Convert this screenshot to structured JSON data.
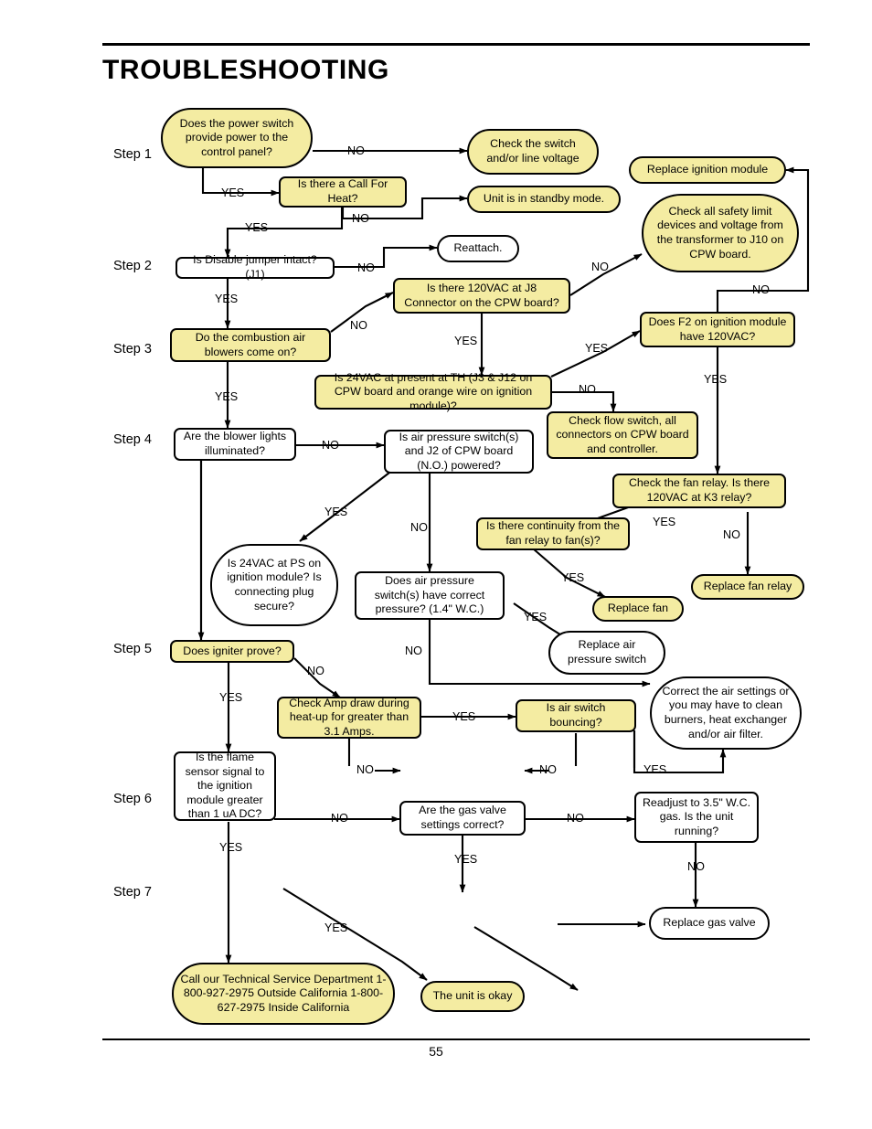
{
  "document": {
    "title": "TROUBLESHOOTING",
    "page_number": "55"
  },
  "steps": [
    {
      "label": "Step 1"
    },
    {
      "label": "Step 2"
    },
    {
      "label": "Step 3"
    },
    {
      "label": "Step 4"
    },
    {
      "label": "Step 5"
    },
    {
      "label": "Step 6"
    },
    {
      "label": "Step 7"
    }
  ],
  "colors": {
    "node_fill_highlight": "#f4eca2",
    "node_fill_plain": "#ffffff",
    "node_border": "#000000",
    "text": "#000000"
  },
  "nodes": {
    "power_switch": "Does the power switch provide power to the control panel?",
    "check_switch": "Check the switch and/or line voltage",
    "call_for_heat": "Is there a Call For Heat?",
    "standby": "Unit is in standby mode.",
    "replace_ignition_module": "Replace ignition module",
    "check_safety_limit": "Check all safety limit devices and voltage from the transformer to J10 on CPW board.",
    "disable_jumper": "Is Disable jumper intact? (J1)",
    "reattach": "Reattach.",
    "vac_j8": "Is there 120VAC at J8 Connector on the CPW board?",
    "f2_module": "Does F2 on ignition module have 120VAC?",
    "combustion_blowers": "Do the combustion air blowers come on?",
    "vac24_th": "Is 24VAC at present at TH (J3 & J12 on CPW board and orange wire on ignition module)?",
    "blower_lights": "Are the blower lights illuminated?",
    "air_pressure_j2": "Is air pressure switch(s) and J2 of CPW board (N.O.) powered?",
    "check_flow_switch": "Check flow switch, all connectors on CPW board and controller.",
    "check_fan_relay": "Check the fan relay. Is there 120VAC at K3 relay?",
    "continuity_fan_relay": "Is there continuity from the fan relay to fan(s)?",
    "vac24_ps": "Is 24VAC at PS on ignition module? Is connecting plug secure?",
    "correct_pressure": "Does air pressure switch(s) have correct pressure? (1.4\" W.C.)",
    "replace_fan": "Replace fan",
    "replace_fan_relay": "Replace fan relay",
    "replace_air_pressure_switch": "Replace air pressure switch",
    "igniter_prove": "Does igniter prove?",
    "check_amp_draw": "Check Amp draw during heat-up for greater than 3.1 Amps.",
    "air_switch_bouncing": "Is air switch bouncing?",
    "correct_air_settings": "Correct the air settings or you may have to clean burners, heat exchanger and/or air filter.",
    "flame_sensor": "Is the flame sensor signal to the ignition module greater than 1 uA DC?",
    "gas_valve_settings": "Are the gas valve settings correct?",
    "readjust_gas": "Readjust to 3.5\" W.C. gas. Is the unit running?",
    "replace_gas_valve": "Replace gas valve",
    "call_service": "Call our Technical Service Department 1-800-927-2975 Outside California 1-800-627-2975 Inside California",
    "unit_okay": "The unit is okay"
  },
  "edge_labels": {
    "no": "NO",
    "yes": "YES"
  },
  "edges": [
    {
      "from": "power_switch",
      "to": "check_switch",
      "label": "NO"
    },
    {
      "from": "power_switch",
      "to": "call_for_heat",
      "label": "YES"
    },
    {
      "from": "call_for_heat",
      "to": "standby",
      "label": "NO"
    },
    {
      "from": "call_for_heat",
      "to": "disable_jumper",
      "label": "YES"
    },
    {
      "from": "disable_jumper",
      "to": "reattach",
      "label": "NO"
    },
    {
      "from": "disable_jumper",
      "to": "combustion_blowers",
      "label": "YES"
    },
    {
      "from": "vac_j8",
      "to": "check_safety_limit",
      "label": "NO"
    },
    {
      "from": "vac_j8",
      "to": "vac24_th",
      "label": "YES"
    },
    {
      "from": "combustion_blowers",
      "to": "vac_j8",
      "label": "NO"
    },
    {
      "from": "combustion_blowers",
      "to": "blower_lights",
      "label": "YES"
    },
    {
      "from": "vac24_th",
      "to": "check_flow_switch",
      "label": "NO"
    },
    {
      "from": "vac24_th",
      "to": "f2_module",
      "label": "YES"
    },
    {
      "from": "f2_module",
      "to": "replace_ignition_module",
      "label": "NO"
    },
    {
      "from": "f2_module",
      "to": "check_fan_relay",
      "label": "YES"
    },
    {
      "from": "check_fan_relay",
      "to": "continuity_fan_relay",
      "label": "YES"
    },
    {
      "from": "check_fan_relay",
      "to": "replace_fan_relay",
      "label": "NO"
    },
    {
      "from": "continuity_fan_relay",
      "to": "replace_fan",
      "label": "YES"
    },
    {
      "from": "blower_lights",
      "to": "air_pressure_j2",
      "label": "NO"
    },
    {
      "from": "blower_lights",
      "to": "igniter_prove",
      "label": ""
    },
    {
      "from": "air_pressure_j2",
      "to": "vac24_ps",
      "label": "YES"
    },
    {
      "from": "air_pressure_j2",
      "to": "correct_pressure",
      "label": "NO"
    },
    {
      "from": "correct_pressure",
      "to": "replace_air_pressure_switch",
      "label": "YES"
    },
    {
      "from": "correct_pressure",
      "to": "correct_air_settings",
      "label": "NO"
    },
    {
      "from": "igniter_prove",
      "to": "check_amp_draw",
      "label": "NO"
    },
    {
      "from": "igniter_prove",
      "to": "flame_sensor",
      "label": "YES"
    },
    {
      "from": "check_amp_draw",
      "to": "air_switch_bouncing",
      "label": "YES"
    },
    {
      "from": "check_amp_draw",
      "to": "",
      "label": "NO"
    },
    {
      "from": "air_switch_bouncing",
      "to": "correct_air_settings",
      "label": "YES"
    },
    {
      "from": "air_switch_bouncing",
      "to": "",
      "label": "NO"
    },
    {
      "from": "flame_sensor",
      "to": "gas_valve_settings",
      "label": "NO"
    },
    {
      "from": "flame_sensor",
      "to": "call_service",
      "label": "YES"
    },
    {
      "from": "gas_valve_settings",
      "to": "readjust_gas",
      "label": "NO"
    },
    {
      "from": "gas_valve_settings",
      "to": "unit_okay",
      "label": "YES"
    },
    {
      "from": "readjust_gas",
      "to": "replace_gas_valve",
      "label": "NO"
    }
  ]
}
